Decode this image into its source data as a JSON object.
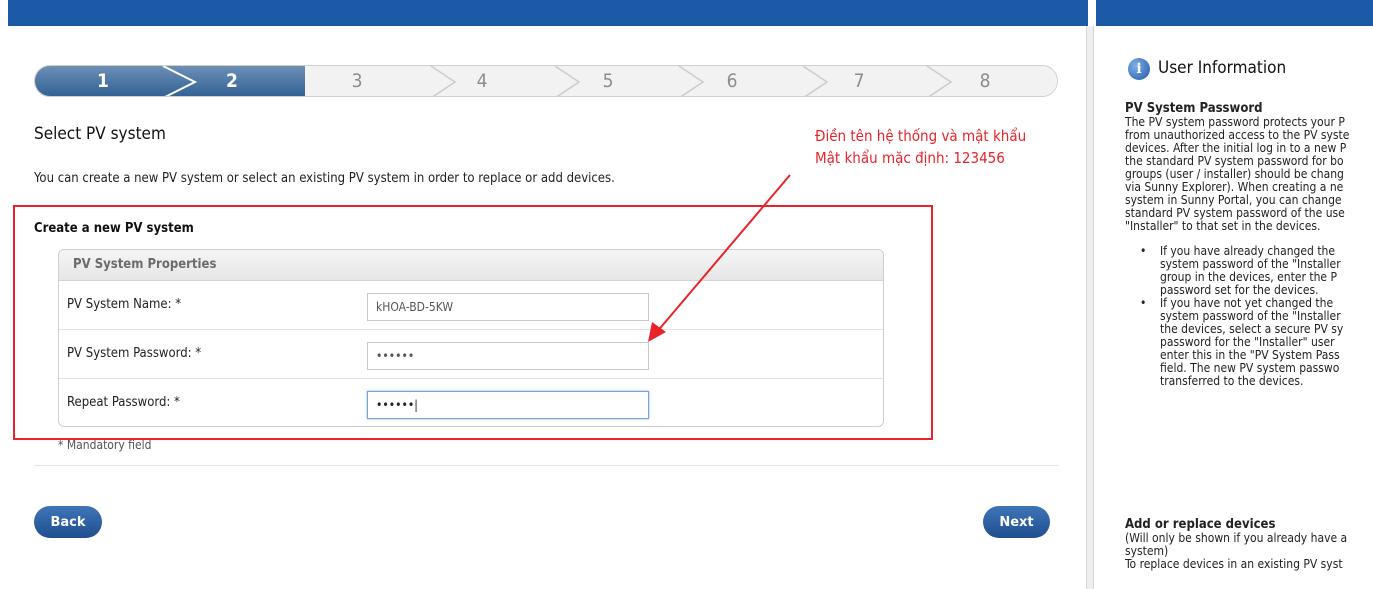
{
  "steps": [
    "1",
    "2",
    "3",
    "4",
    "5",
    "6",
    "7",
    "8"
  ],
  "page_title": "Select PV system",
  "intro": "You can create a new PV system or select an existing PV system in order to replace or add devices.",
  "section_title": "Create a new PV system",
  "properties": {
    "header": "PV System Properties",
    "rows": [
      {
        "label": "PV System Name: *",
        "value": "kHOA-BD-5KW"
      },
      {
        "label": "PV System Password: *",
        "value": "••••••"
      },
      {
        "label": "Repeat Password: *",
        "value": "••••••|"
      }
    ]
  },
  "mandatory_note": "* Mandatory field",
  "buttons": {
    "back": "Back",
    "next": "Next"
  },
  "annotation": {
    "line1": "Điền tên hệ thống và mật khẩu",
    "line2": "Mật khẩu mặc định: 123456",
    "color": "#e8242a"
  },
  "info": {
    "title": "User Information",
    "pw_heading": "PV System Password",
    "pw_lines": [
      "The PV system password protects your P",
      "from unauthorized access to the PV syste",
      "devices. After the initial log in to a new P",
      "the standard PV system password for bo",
      "groups (user / installer) should be chang",
      "via Sunny Explorer). When creating a ne",
      "system in Sunny Portal, you can change",
      "standard PV system password of the use",
      "\"Installer\" to that set in the devices."
    ],
    "bullet1": [
      "If you have already changed the",
      "system password of the \"Installer",
      "group in the devices, enter the P",
      "password set for the devices."
    ],
    "bullet2": [
      "If you have not yet changed the",
      "system password of the \"Installer",
      "the devices, select a secure PV sy",
      "password for the \"Installer\" user",
      "enter this in the \"PV System Pass",
      "field. The new PV system passwo",
      "transferred to the devices."
    ],
    "add_heading": "Add or replace devices",
    "add_lines": [
      "(Will only be shown if you already have a",
      "system)",
      "To replace devices in an existing PV syst"
    ]
  },
  "colors": {
    "brand": "#1c5aa8",
    "accent_red": "#e8242a"
  }
}
